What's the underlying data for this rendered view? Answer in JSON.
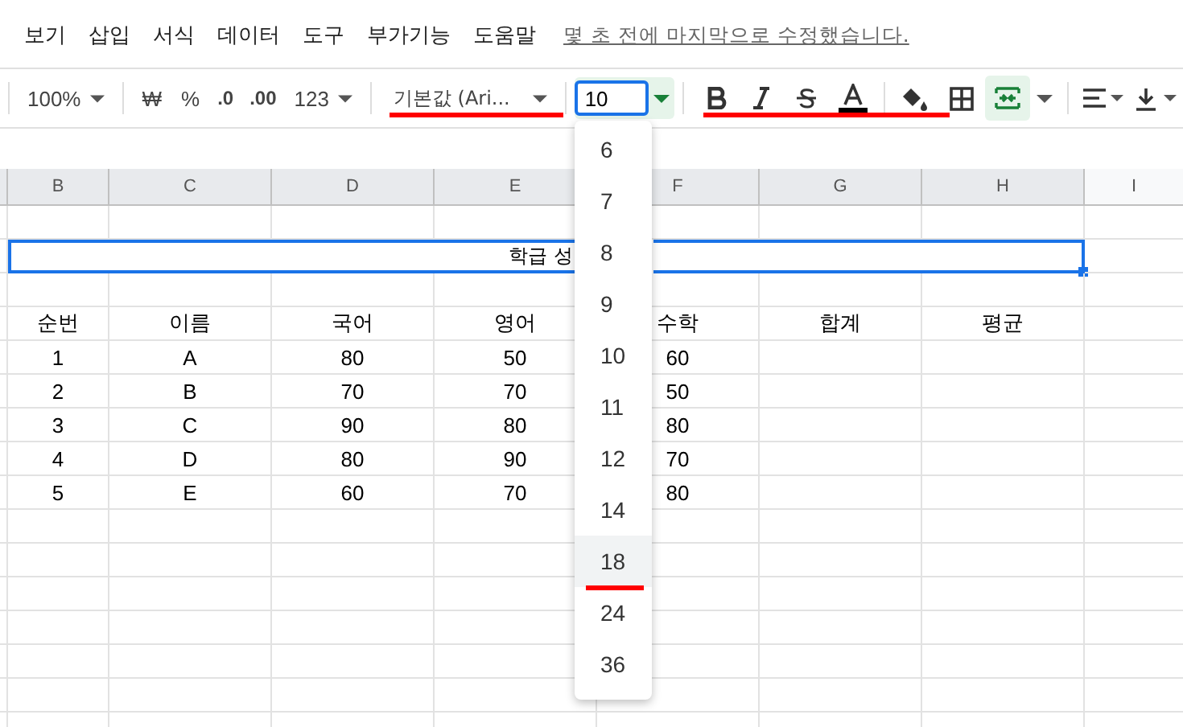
{
  "menu": {
    "items": [
      "보기",
      "삽입",
      "서식",
      "데이터",
      "도구",
      "부가기능",
      "도움말"
    ],
    "last_edit": "몇 초 전에 마지막으로 수정했습니다."
  },
  "toolbar": {
    "zoom": "100%",
    "currency": "₩",
    "percent": "%",
    "decrease_decimals": ".0",
    "increase_decimals": ".00",
    "number_format": "123",
    "font": "기본값 (Ari...",
    "font_size": "10"
  },
  "sheet": {
    "columns": [
      "B",
      "C",
      "D",
      "E",
      "F",
      "G",
      "H",
      "I"
    ],
    "title": "학급 성",
    "rows": [
      [
        "순번",
        "이름",
        "국어",
        "영어",
        "수학",
        "합계",
        "평균"
      ],
      [
        "1",
        "A",
        "80",
        "50",
        "60",
        "",
        ""
      ],
      [
        "2",
        "B",
        "70",
        "70",
        "50",
        "",
        ""
      ],
      [
        "3",
        "C",
        "90",
        "80",
        "80",
        "",
        ""
      ],
      [
        "4",
        "D",
        "80",
        "90",
        "70",
        "",
        ""
      ],
      [
        "5",
        "E",
        "60",
        "70",
        "80",
        "",
        ""
      ]
    ]
  },
  "font_size_menu": [
    {
      "label": "6",
      "selected": false
    },
    {
      "label": "7",
      "selected": false
    },
    {
      "label": "8",
      "selected": false
    },
    {
      "label": "9",
      "selected": false
    },
    {
      "label": "10",
      "selected": false
    },
    {
      "label": "11",
      "selected": false
    },
    {
      "label": "12",
      "selected": false
    },
    {
      "label": "14",
      "selected": false
    },
    {
      "label": "18",
      "selected": true
    },
    {
      "label": "24",
      "selected": false
    },
    {
      "label": "36",
      "selected": false
    }
  ]
}
